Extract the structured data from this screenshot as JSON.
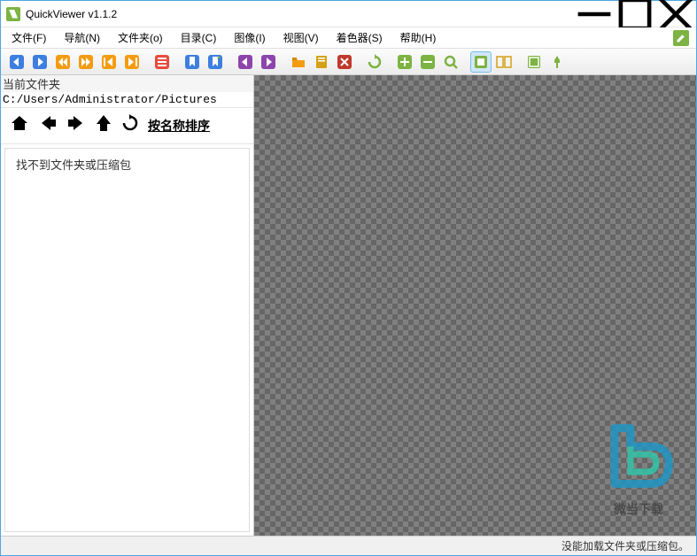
{
  "window": {
    "title": "QuickViewer v1.1.2"
  },
  "menu": {
    "file": "文件(F)",
    "nav": "导航(N)",
    "folder": "文件夹(o)",
    "catalog": "目录(C)",
    "image": "图像(I)",
    "view": "视图(V)",
    "shader": "着色器(S)",
    "help": "帮助(H)"
  },
  "sidebar": {
    "current_folder_label": "当前文件夹",
    "path": "C:/Users/Administrator/Pictures",
    "sort_label": "按名称排序",
    "empty_message": "找不到文件夹或压缩包"
  },
  "watermark": {
    "text": "微当下载"
  },
  "status": {
    "message": "没能加载文件夹或压缩包。"
  },
  "colors": {
    "blue": "#3d7fe0",
    "orange": "#f39c12",
    "purple": "#8e44ad",
    "green": "#7cb342",
    "teal": "#16a085",
    "yellow": "#d4a017"
  }
}
